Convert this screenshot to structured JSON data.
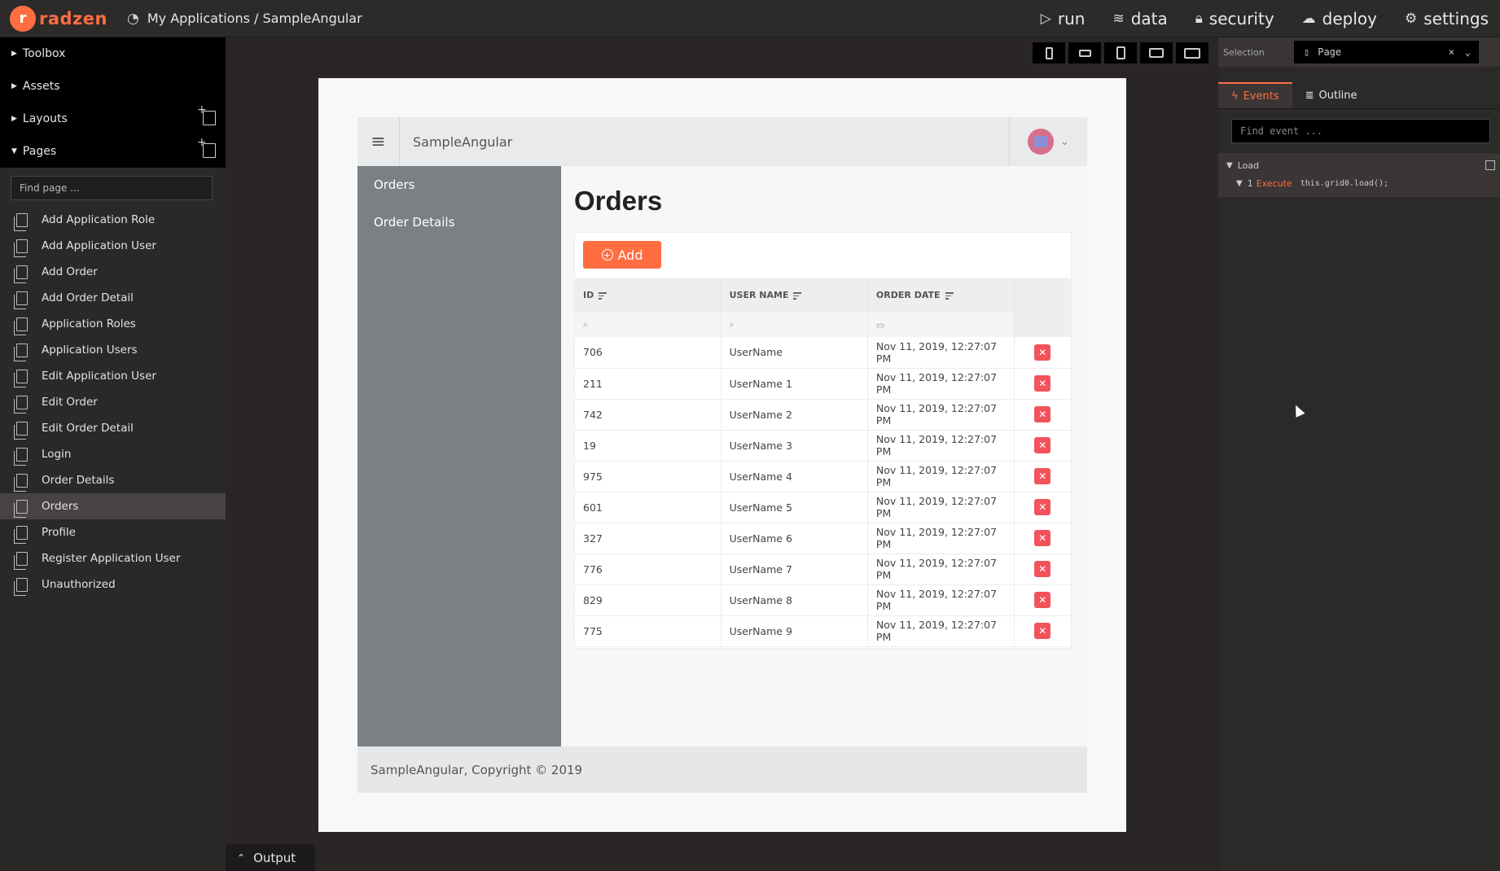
{
  "app": {
    "logo_letter": "r",
    "logo_text": "radzen",
    "breadcrumb": "My Applications / SampleAngular"
  },
  "topnav": [
    {
      "label": "run",
      "icon": "play-icon"
    },
    {
      "label": "data",
      "icon": "layers-icon"
    },
    {
      "label": "security",
      "icon": "lock-icon"
    },
    {
      "label": "deploy",
      "icon": "cloud-upload-icon"
    },
    {
      "label": "settings",
      "icon": "gear-icon"
    }
  ],
  "left": {
    "sections": {
      "toolbox": "Toolbox",
      "assets": "Assets",
      "layouts": "Layouts",
      "pages": "Pages"
    },
    "find_placeholder": "Find page ...",
    "pages": [
      "Add Application Role",
      "Add Application User",
      "Add Order",
      "Add Order Detail",
      "Application Roles",
      "Application Users",
      "Edit Application User",
      "Edit Order",
      "Edit Order Detail",
      "Login",
      "Order Details",
      "Orders",
      "Profile",
      "Register Application User",
      "Unauthorized"
    ],
    "active_page": "Orders"
  },
  "preview": {
    "app_title": "SampleAngular",
    "nav": [
      "Orders",
      "Order Details"
    ],
    "page_title": "Orders",
    "add_label": "Add",
    "columns": [
      "ID",
      "USER NAME",
      "ORDER DATE"
    ],
    "rows": [
      {
        "id": "706",
        "user": "UserName",
        "date": "Nov 11, 2019, 12:27:07 PM"
      },
      {
        "id": "211",
        "user": "UserName 1",
        "date": "Nov 11, 2019, 12:27:07 PM"
      },
      {
        "id": "742",
        "user": "UserName 2",
        "date": "Nov 11, 2019, 12:27:07 PM"
      },
      {
        "id": "19",
        "user": "UserName 3",
        "date": "Nov 11, 2019, 12:27:07 PM"
      },
      {
        "id": "975",
        "user": "UserName 4",
        "date": "Nov 11, 2019, 12:27:07 PM"
      },
      {
        "id": "601",
        "user": "UserName 5",
        "date": "Nov 11, 2019, 12:27:07 PM"
      },
      {
        "id": "327",
        "user": "UserName 6",
        "date": "Nov 11, 2019, 12:27:07 PM"
      },
      {
        "id": "776",
        "user": "UserName 7",
        "date": "Nov 11, 2019, 12:27:07 PM"
      },
      {
        "id": "829",
        "user": "UserName 8",
        "date": "Nov 11, 2019, 12:27:07 PM"
      },
      {
        "id": "775",
        "user": "UserName 9",
        "date": "Nov 11, 2019, 12:27:07 PM"
      }
    ],
    "footer": "SampleAngular, Copyright © 2019"
  },
  "output_label": "Output",
  "right": {
    "selection_label": "Selection",
    "selection_value": "Page",
    "tabs": {
      "events": "Events",
      "outline": "Outline"
    },
    "find_event_placeholder": "Find event ...",
    "event_name": "Load",
    "action_index": "1",
    "action_type": "Execute",
    "action_code": "this.grid0.load();"
  },
  "colors": {
    "accent": "#ff6d41",
    "delete": "#f2535a",
    "sidebar": "#7b8084"
  }
}
